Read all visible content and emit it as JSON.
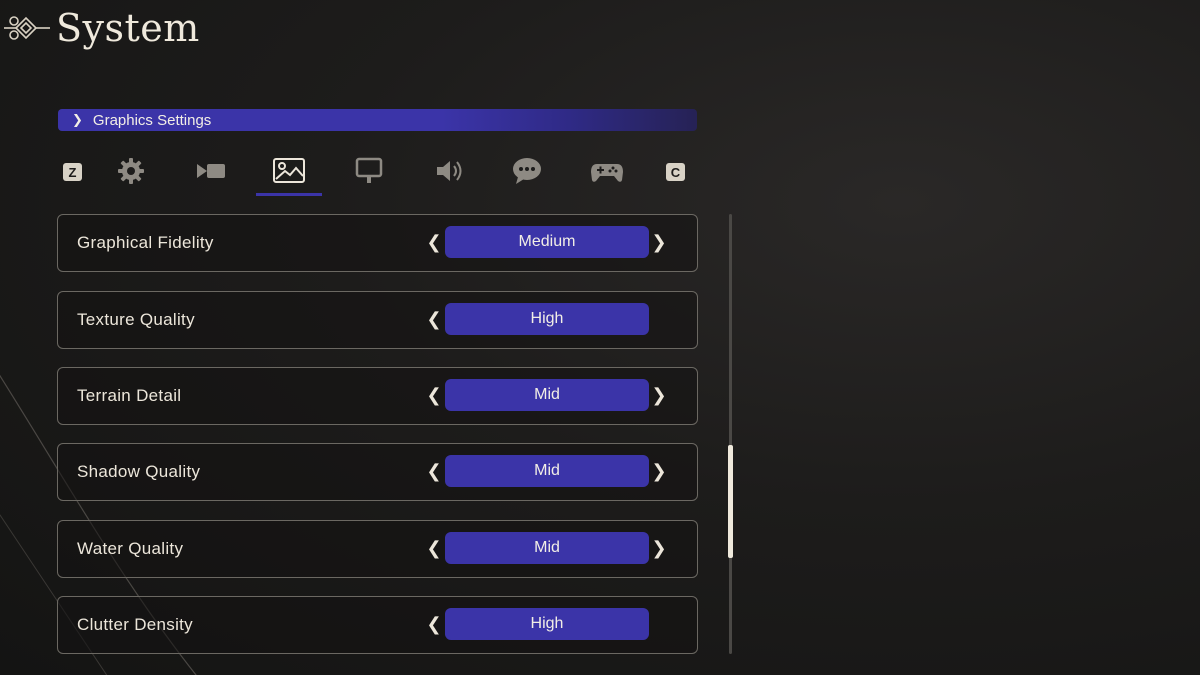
{
  "header": {
    "title": "System"
  },
  "section": {
    "label": "Graphics Settings"
  },
  "tabs": {
    "prev_key": "Z",
    "next_key": "C",
    "items": [
      {
        "icon": "gear-icon"
      },
      {
        "icon": "video-camera-icon"
      },
      {
        "icon": "image-icon",
        "active": true
      },
      {
        "icon": "monitor-icon"
      },
      {
        "icon": "speaker-icon"
      },
      {
        "icon": "chat-bubble-icon"
      },
      {
        "icon": "gamepad-icon"
      }
    ]
  },
  "settings": [
    {
      "label": "Graphical Fidelity",
      "value": "Medium",
      "has_left": true,
      "has_right": true
    },
    {
      "label": "Texture Quality",
      "value": "High",
      "has_left": true,
      "has_right": false
    },
    {
      "label": "Terrain Detail",
      "value": "Mid",
      "has_left": true,
      "has_right": true
    },
    {
      "label": "Shadow Quality",
      "value": "Mid",
      "has_left": true,
      "has_right": true
    },
    {
      "label": "Water Quality",
      "value": "Mid",
      "has_left": true,
      "has_right": true
    },
    {
      "label": "Clutter Density",
      "value": "High",
      "has_left": true,
      "has_right": false
    }
  ],
  "colors": {
    "accent": "#3b34a8",
    "text": "#ece6da",
    "background": "#1d1c1b"
  }
}
